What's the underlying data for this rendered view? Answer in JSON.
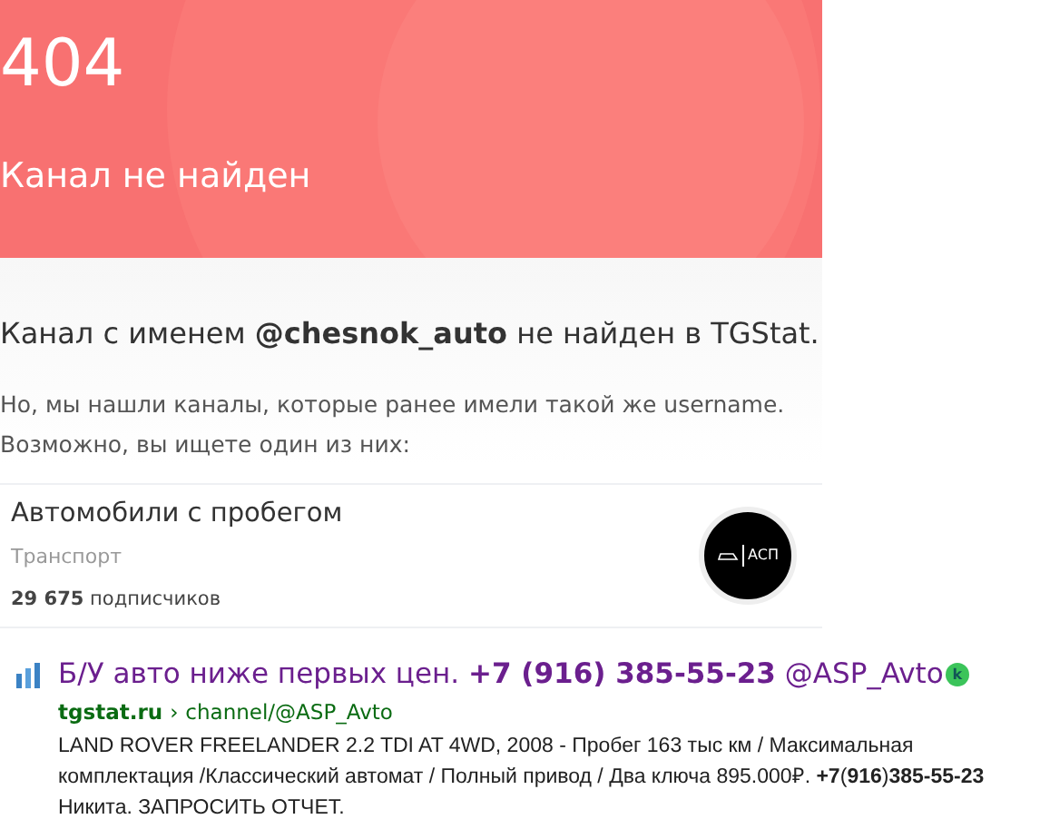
{
  "banner": {
    "code": "404",
    "title": "Канал не найден"
  },
  "message": "Канал с именем **@chesnok_auto** не найден в TGStat.",
  "hint": [
    "Но, мы нашли каналы, которые ранее имели такой же username.",
    "Возможно, вы ищете один из них:"
  ],
  "channel_card": {
    "name": "Автомобили с пробегом",
    "category": "Транспорт",
    "subscribers_count": "29 675",
    "subscribers_label": "подписчиков",
    "avatar_label": "АСП"
  },
  "search_result": {
    "title": "Б/У авто ниже первых цен. **+7 (916) 385-55-23** @ASP_Avto",
    "badge": "k",
    "url_host": "tgstat.ru",
    "url_separator": "›",
    "url_path": "channel/@ASP_Avto",
    "snippet": "LAND ROVER FREELANDER 2.2 TDI AT 4WD, 2008 - Пробег 163 тыс км / Максимальная комплектация /Классический автомат / Полный привод / Два ключа 895.000₽. **+7**(**916**)**385-55-23** Никита. ЗАПРОСИТЬ ОТЧЕТ."
  }
}
